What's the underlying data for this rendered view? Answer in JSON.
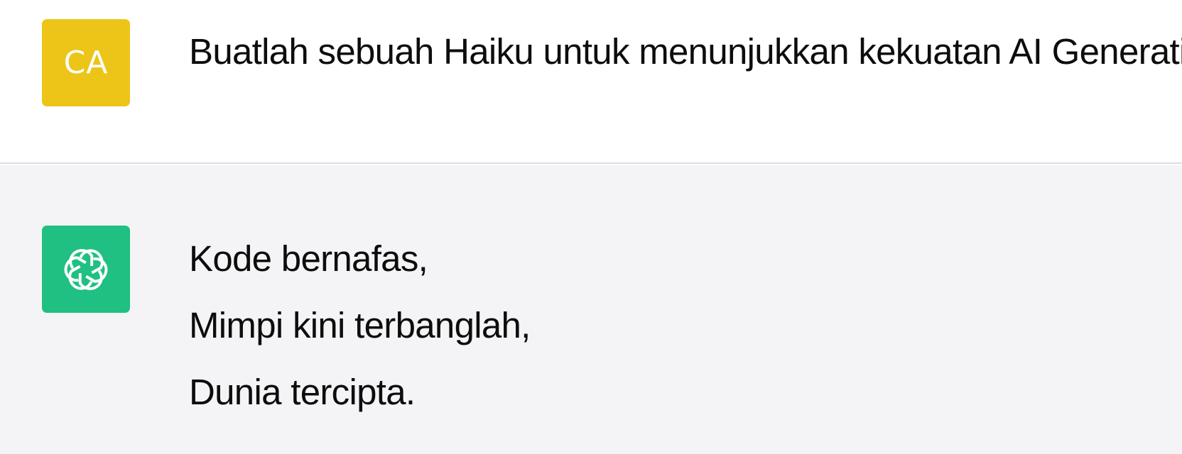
{
  "colors": {
    "user_avatar": "#EDC418",
    "assistant_avatar": "#1FC081",
    "assistant_background": "#F4F4F6",
    "divider": "#DEDEE3"
  },
  "user_message": {
    "avatar": {
      "initials": "CA"
    },
    "text": "Buatlah sebuah Haiku untuk menunjukkan kekuatan AI Generatif"
  },
  "assistant_message": {
    "avatar": {
      "icon": "openai-logo-icon"
    },
    "lines": [
      "Kode bernafas,",
      "Mimpi kini terbanglah,",
      "Dunia tercipta."
    ]
  }
}
